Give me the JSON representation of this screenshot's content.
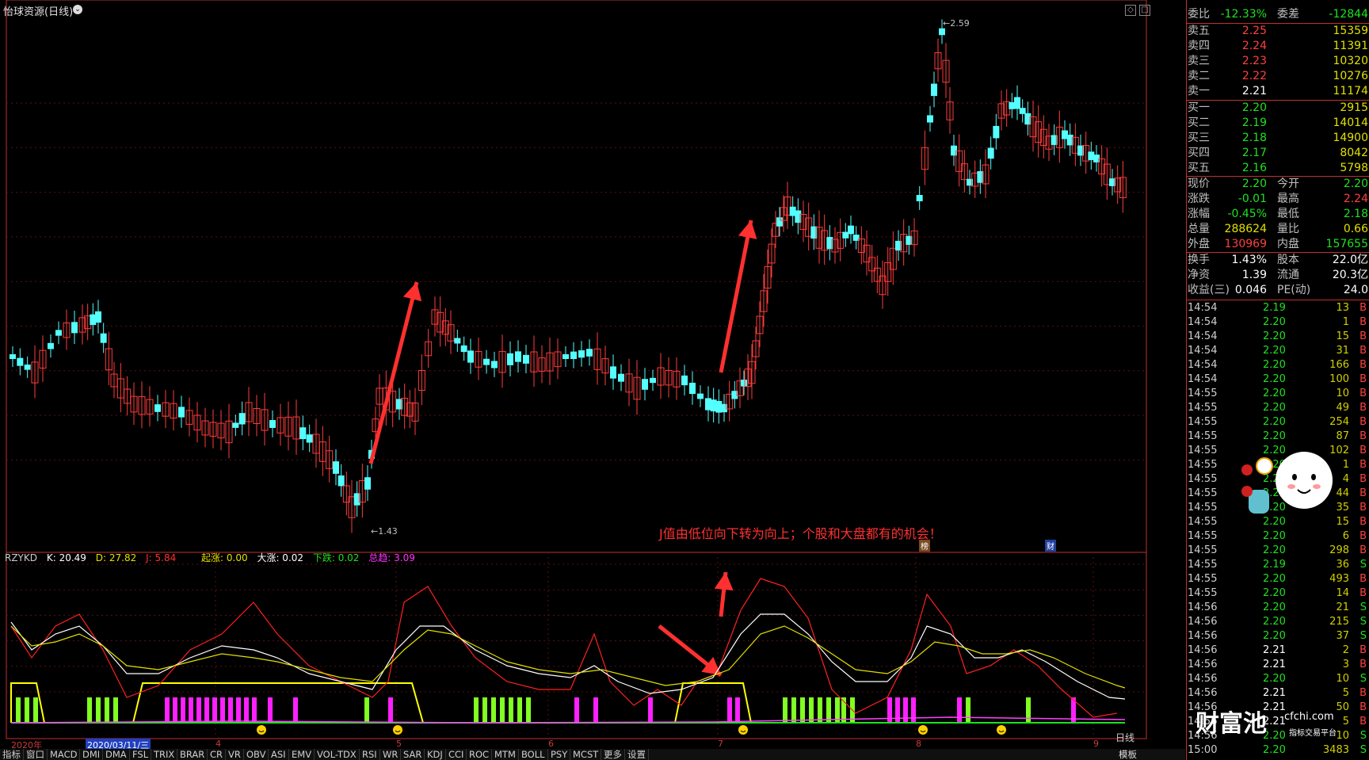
{
  "window": {
    "title": "怡球资源(日线)",
    "period_label": "日线",
    "template_label": "模板"
  },
  "price_axis": [
    "2.40",
    "2.30",
    "2.20",
    "2.10",
    "2.00",
    "1.90",
    "1.80",
    "1.70",
    "1.60"
  ],
  "price_marks": {
    "high": "2.59",
    "low": "1.43"
  },
  "indicator": {
    "name": "RZYKD",
    "k_label": "K:",
    "k_value": "20.49",
    "d_label": "D:",
    "d_value": "27.82",
    "j_label": "J:",
    "j_value": "5.84",
    "qizhang": "起涨: 0.00",
    "dazhang": "大涨: 0.02",
    "xiadie": "下跌: 0.02",
    "zongqu": "总趋: 3.09",
    "axis": [
      "120.0",
      "100.0",
      "80.00",
      "60.00",
      "40.00",
      "20.00"
    ]
  },
  "annotation": "J值由低位向下转为向上；个股和大盘都有的机会！",
  "badges": {
    "bang": "榜",
    "cai": "财"
  },
  "x_axis": {
    "year": "2020年",
    "current_date": "2020/03/11/三",
    "months": [
      "4",
      "5",
      "6",
      "7",
      "8",
      "9"
    ]
  },
  "tabs": [
    "指标",
    "窗口",
    "MACD",
    "DMI",
    "DMA",
    "FSL",
    "TRIX",
    "BRAR",
    "CR",
    "VR",
    "OBV",
    "ASI",
    "EMV",
    "VOL-TDX",
    "RSI",
    "WR",
    "SAR",
    "KDJ",
    "CCI",
    "ROC",
    "MTM",
    "BOLL",
    "PSY",
    "MCST",
    "更多",
    "设置"
  ],
  "quote": {
    "header": {
      "weibi_label": "委比",
      "weibi": "-12.33%",
      "weicha_label": "委差",
      "weicha": "-12844"
    },
    "asks": [
      {
        "label": "卖五",
        "price": "2.25",
        "vol": "15359"
      },
      {
        "label": "卖四",
        "price": "2.24",
        "vol": "11391"
      },
      {
        "label": "卖三",
        "price": "2.23",
        "vol": "10320"
      },
      {
        "label": "卖二",
        "price": "2.22",
        "vol": "10276"
      },
      {
        "label": "卖一",
        "price": "2.21",
        "vol": "11174"
      }
    ],
    "bids": [
      {
        "label": "买一",
        "price": "2.20",
        "vol": "2915"
      },
      {
        "label": "买二",
        "price": "2.19",
        "vol": "14014"
      },
      {
        "label": "买三",
        "price": "2.18",
        "vol": "14900"
      },
      {
        "label": "买四",
        "price": "2.17",
        "vol": "8042"
      },
      {
        "label": "买五",
        "price": "2.16",
        "vol": "5798"
      }
    ],
    "stats": [
      {
        "l1": "现价",
        "v1": "2.20",
        "c1": "green",
        "l2": "今开",
        "v2": "2.20",
        "c2": "green"
      },
      {
        "l1": "涨跌",
        "v1": "-0.01",
        "c1": "green",
        "l2": "最高",
        "v2": "2.24",
        "c2": "red"
      },
      {
        "l1": "涨幅",
        "v1": "-0.45%",
        "c1": "green",
        "l2": "最低",
        "v2": "2.18",
        "c2": "green"
      },
      {
        "l1": "总量",
        "v1": "288624",
        "c1": "yellow",
        "l2": "量比",
        "v2": "0.66",
        "c2": "yellow"
      },
      {
        "l1": "外盘",
        "v1": "130969",
        "c1": "red",
        "l2": "内盘",
        "v2": "157655",
        "c2": "green"
      }
    ],
    "stats2": [
      {
        "l1": "换手",
        "v1": "1.43%",
        "l2": "股本",
        "v2": "22.0亿"
      },
      {
        "l1": "净资",
        "v1": "1.39",
        "l2": "流通",
        "v2": "20.3亿"
      },
      {
        "l1": "收益(三)",
        "v1": "0.046",
        "l2": "PE(动)",
        "v2": "24.0"
      }
    ],
    "ticks": [
      {
        "t": "14:54",
        "p": "2.19",
        "v": "13",
        "s": "B"
      },
      {
        "t": "14:54",
        "p": "2.20",
        "v": "1",
        "s": "B"
      },
      {
        "t": "14:54",
        "p": "2.20",
        "v": "15",
        "s": "B"
      },
      {
        "t": "14:54",
        "p": "2.20",
        "v": "31",
        "s": "B"
      },
      {
        "t": "14:54",
        "p": "2.20",
        "v": "166",
        "s": "B"
      },
      {
        "t": "14:54",
        "p": "2.20",
        "v": "100",
        "s": "B"
      },
      {
        "t": "14:55",
        "p": "2.20",
        "v": "10",
        "s": "B"
      },
      {
        "t": "14:55",
        "p": "2.20",
        "v": "49",
        "s": "B"
      },
      {
        "t": "14:55",
        "p": "2.20",
        "v": "254",
        "s": "B"
      },
      {
        "t": "14:55",
        "p": "2.20",
        "v": "87",
        "s": "B"
      },
      {
        "t": "14:55",
        "p": "2.20",
        "v": "102",
        "s": "B"
      },
      {
        "t": "14:55",
        "p": "2.20",
        "v": "1",
        "s": "B"
      },
      {
        "t": "14:55",
        "p": "2.20",
        "v": "4",
        "s": "B"
      },
      {
        "t": "14:55",
        "p": "2.20",
        "v": "44",
        "s": "B"
      },
      {
        "t": "14:55",
        "p": "2.20",
        "v": "35",
        "s": "B"
      },
      {
        "t": "14:55",
        "p": "2.20",
        "v": "15",
        "s": "B"
      },
      {
        "t": "14:55",
        "p": "2.20",
        "v": "6",
        "s": "B"
      },
      {
        "t": "14:55",
        "p": "2.20",
        "v": "298",
        "s": "B"
      },
      {
        "t": "14:55",
        "p": "2.19",
        "v": "36",
        "s": "S"
      },
      {
        "t": "14:55",
        "p": "2.20",
        "v": "493",
        "s": "B"
      },
      {
        "t": "14:55",
        "p": "2.20",
        "v": "14",
        "s": "B"
      },
      {
        "t": "14:56",
        "p": "2.20",
        "v": "21",
        "s": "S"
      },
      {
        "t": "14:56",
        "p": "2.20",
        "v": "215",
        "s": "S"
      },
      {
        "t": "14:56",
        "p": "2.20",
        "v": "37",
        "s": "S"
      },
      {
        "t": "14:56",
        "p": "2.21",
        "v": "2",
        "s": "B"
      },
      {
        "t": "14:56",
        "p": "2.21",
        "v": "3",
        "s": "B"
      },
      {
        "t": "14:56",
        "p": "2.20",
        "v": "10",
        "s": "S"
      },
      {
        "t": "14:56",
        "p": "2.21",
        "v": "5",
        "s": "B"
      },
      {
        "t": "14:56",
        "p": "2.21",
        "v": "50",
        "s": "B"
      },
      {
        "t": "14:56",
        "p": "2.21",
        "v": "5",
        "s": "B"
      },
      {
        "t": "14:56",
        "p": "2.20",
        "v": "10",
        "s": "S"
      },
      {
        "t": "15:00",
        "p": "2.20",
        "v": "3483",
        "s": "S"
      }
    ]
  },
  "logo": {
    "main": "财富池",
    "site": "cfchi.com",
    "slogan": "指标交易平台"
  },
  "colors": {
    "up": "#ff3c3c",
    "down": "#54ffff",
    "k": "#ffffff",
    "d": "#e0e000",
    "j": "#ff2020",
    "panel_border": "#c03030"
  }
}
